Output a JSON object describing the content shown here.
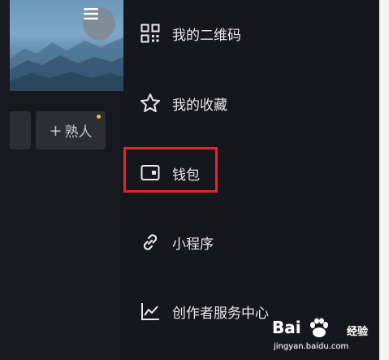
{
  "friends_panel": {
    "add_chip": {
      "plus": "+",
      "label": "熟人"
    }
  },
  "drawer": {
    "items": [
      {
        "label": "我的二维码",
        "icon": "qr-code-icon"
      },
      {
        "label": "我的收藏",
        "icon": "star-icon"
      },
      {
        "label": "钱包",
        "icon": "wallet-icon"
      },
      {
        "label": "小程序",
        "icon": "link-icon"
      },
      {
        "label": "创作者服务中心",
        "icon": "chart-icon"
      }
    ],
    "highlighted_item": "钱包",
    "highlight_color": "#e3262a"
  },
  "watermark": {
    "logo": "Bai  ",
    "brand": "经验",
    "url": "jingyan.baidu.com"
  },
  "colors": {
    "drawer_bg": "#16161e",
    "notification_dot": "#f4c21a"
  }
}
